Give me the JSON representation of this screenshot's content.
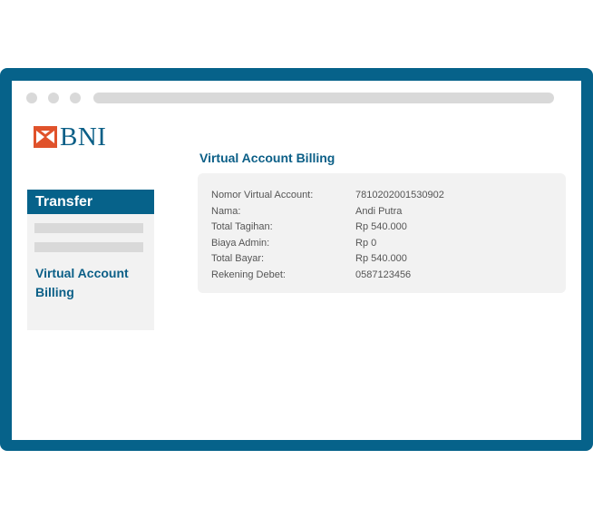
{
  "brand": {
    "name": "BNI",
    "accent": "#06628a",
    "logo_accent": "#e0522b"
  },
  "browser": {
    "icons": [
      "window-dot",
      "window-dot",
      "window-dot"
    ]
  },
  "sidebar": {
    "header": "Transfer",
    "link": "Virtual Account Billing"
  },
  "main": {
    "title": "Virtual Account Billing",
    "rows": [
      {
        "label": "Nomor Virtual Account:",
        "value": "7810202001530902"
      },
      {
        "label": "Nama:",
        "value": "Andi Putra"
      },
      {
        "label": "Total Tagihan:",
        "value": "Rp 540.000"
      },
      {
        "label": "Biaya Admin:",
        "value": "Rp 0"
      },
      {
        "label": "Total Bayar:",
        "value": "Rp 540.000"
      },
      {
        "label": "Rekening Debet:",
        "value": "0587123456"
      }
    ]
  }
}
